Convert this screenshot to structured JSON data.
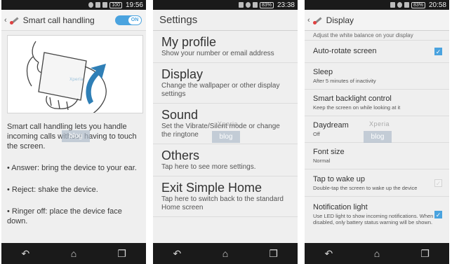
{
  "panels": {
    "smart_call": {
      "status": {
        "battery": "100",
        "time": "19:56"
      },
      "title": "Smart call handling",
      "toggle_label": "ON",
      "intro": "Smart call handling lets you handle incoming calls without having to touch the screen.",
      "bullets": [
        "• Answer: bring the device to your ear.",
        "• Reject: shake the device.",
        "• Ringer off: place the device face down."
      ],
      "watermark": "blog"
    },
    "settings": {
      "status": {
        "battery": "83%",
        "time": "23:38"
      },
      "title": "Settings",
      "items": [
        {
          "title": "My profile",
          "subtitle": "Show your number or email address"
        },
        {
          "title": "Display",
          "subtitle": "Change the wallpaper or other display settings"
        },
        {
          "title": "Sound",
          "subtitle": "Set the Vibrate/Silent mode or change the ringtone"
        },
        {
          "title": "Others",
          "subtitle": "Tap here to see more settings."
        },
        {
          "title": "Exit Simple Home",
          "subtitle": "Tap here to switch back to the standard Home screen"
        }
      ],
      "watermark_top": "Xperia",
      "watermark": "blog"
    },
    "display": {
      "status": {
        "battery": "83%",
        "time": "20:58"
      },
      "title": "Display",
      "cut_text": "Adjust the white balance on your display",
      "items": [
        {
          "title": "Auto-rotate screen",
          "subtitle": "",
          "checkbox": "checked"
        },
        {
          "title": "Sleep",
          "subtitle": "After 5 minutes of inactivity",
          "checkbox": "none"
        },
        {
          "title": "Smart backlight control",
          "subtitle": "Keep the screen on while looking at it",
          "checkbox": "none"
        },
        {
          "title": "Daydream",
          "subtitle": "Off",
          "checkbox": "none"
        },
        {
          "title": "Font size",
          "subtitle": "Normal",
          "checkbox": "none"
        },
        {
          "title": "Tap to wake up",
          "subtitle": "Double-tap the screen to wake up the device",
          "checkbox": "unchecked"
        },
        {
          "title": "Notification light",
          "subtitle": "Use LED light to show incoming notifications. When disabled, only battery status warning will be shown.",
          "checkbox": "checked"
        }
      ],
      "watermark_top": "Xperia",
      "watermark": "blog"
    }
  },
  "nav": {
    "back": "↶",
    "home": "⌂",
    "recent": "❐"
  },
  "colors": {
    "accent": "#4aa3df",
    "bars": "#1a1a1a",
    "background": "#efefef"
  }
}
